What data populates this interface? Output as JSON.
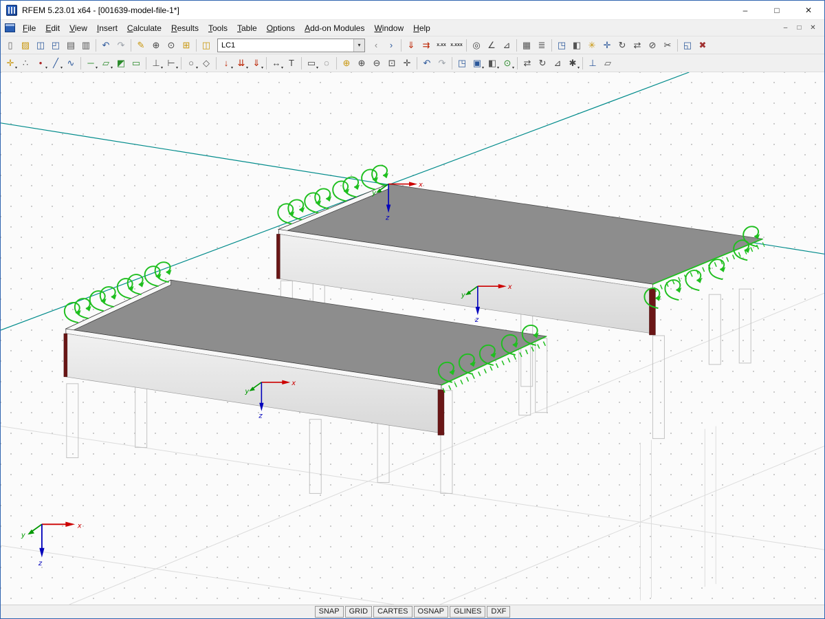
{
  "window": {
    "title": "RFEM 5.23.01 x64 - [001639-model-file-1*]",
    "controls": {
      "minimize": "–",
      "maximize": "□",
      "close": "✕"
    }
  },
  "menubar": {
    "items": [
      "File",
      "Edit",
      "View",
      "Insert",
      "Calculate",
      "Results",
      "Tools",
      "Table",
      "Options",
      "Add-on Modules",
      "Window",
      "Help"
    ],
    "mdi_controls": [
      {
        "n": "mdi-minimize-button",
        "g": "–"
      },
      {
        "n": "mdi-restore-button",
        "g": "□"
      },
      {
        "n": "mdi-close-button",
        "g": "✕"
      }
    ]
  },
  "toolbar_main": {
    "load_case": "LC1",
    "left_icons": [
      {
        "n": "new-file-button",
        "g": "▯",
        "c": "#666"
      },
      {
        "n": "open-file-button",
        "g": "▨",
        "c": "#c8960c"
      },
      {
        "n": "save-button",
        "g": "◫",
        "c": "#2b579a"
      },
      {
        "n": "save-all-button",
        "g": "◰",
        "c": "#2b579a"
      },
      {
        "n": "print-button",
        "g": "▤",
        "c": "#555"
      },
      {
        "n": "print-preview-button",
        "g": "▥",
        "c": "#555"
      },
      {
        "sep": true
      },
      {
        "n": "undo-button",
        "g": "↶",
        "c": "#2b579a"
      },
      {
        "n": "redo-button",
        "g": "↷",
        "c": "#9aa0a8"
      },
      {
        "sep": true
      },
      {
        "n": "edit-button",
        "g": "✎",
        "c": "#c8960c"
      },
      {
        "n": "zoom-select-button",
        "g": "⊕",
        "c": "#444"
      },
      {
        "n": "search-button",
        "g": "⊙",
        "c": "#444"
      },
      {
        "n": "new-window-button",
        "g": "⊞",
        "c": "#c8960c"
      },
      {
        "sep": true
      },
      {
        "n": "load-cases-button",
        "g": "◫",
        "c": "#c8960c"
      }
    ],
    "right_icons": [
      {
        "n": "previous-load-case-button",
        "g": "‹",
        "c": "#888"
      },
      {
        "n": "next-load-case-button",
        "g": "›",
        "c": "#2b579a"
      },
      {
        "sep": true
      },
      {
        "n": "show-loads-button",
        "g": "⇓",
        "c": "#bb2200"
      },
      {
        "n": "show-results-button",
        "g": "⇉",
        "c": "#bb2200"
      },
      {
        "n": "result-values-button",
        "g": "x.xx",
        "small": true,
        "c": "#333"
      },
      {
        "n": "result-digits-button",
        "g": "x.xxx",
        "small": true,
        "c": "#333"
      },
      {
        "sep": true
      },
      {
        "n": "snap-target-button",
        "g": "◎",
        "c": "#444"
      },
      {
        "n": "measure-angle-button",
        "g": "∠",
        "c": "#444"
      },
      {
        "n": "measure-button",
        "g": "⊿",
        "c": "#444"
      },
      {
        "sep": true
      },
      {
        "n": "tables-button",
        "g": "▦",
        "c": "#555"
      },
      {
        "n": "printout-report-button",
        "g": "≣",
        "c": "#555"
      },
      {
        "sep": true
      },
      {
        "n": "isometric-view-button",
        "g": "◳",
        "c": "#2b579a"
      },
      {
        "n": "render-button",
        "g": "◧",
        "c": "#555"
      },
      {
        "n": "lighting-button",
        "g": "✳",
        "c": "#c8960c"
      },
      {
        "n": "axes-button",
        "g": "✛",
        "c": "#2b579a"
      },
      {
        "n": "rotate-view-button",
        "g": "↻",
        "c": "#444"
      },
      {
        "n": "mirror-button",
        "g": "⇄",
        "c": "#444"
      },
      {
        "n": "section-button",
        "g": "⊘",
        "c": "#444"
      },
      {
        "n": "clip-button",
        "g": "✂",
        "c": "#444"
      },
      {
        "sep": true
      },
      {
        "n": "new-child-window-button",
        "g": "◱",
        "c": "#2b579a"
      },
      {
        "n": "close-results-button",
        "g": "✖",
        "c": "#a03030"
      }
    ]
  },
  "toolbar_secondary": {
    "icons": [
      {
        "n": "set-origin-button",
        "g": "✛",
        "c": "#c8960c",
        "dd": true
      },
      {
        "n": "snap-settings-button",
        "g": "∴",
        "c": "#555"
      },
      {
        "n": "new-node-button",
        "g": "•",
        "c": "#aa2222",
        "dd": true
      },
      {
        "n": "new-line-button",
        "g": "╱",
        "c": "#2b579a",
        "dd": true
      },
      {
        "n": "new-polyline-button",
        "g": "∿",
        "c": "#2b579a"
      },
      {
        "sep": true
      },
      {
        "n": "new-member-button",
        "g": "─",
        "c": "#2a8a2a",
        "dd": true
      },
      {
        "n": "new-surface-button",
        "g": "▱",
        "c": "#2a8a2a",
        "dd": true
      },
      {
        "n": "new-solid-button",
        "g": "◩",
        "c": "#2a8a2a"
      },
      {
        "n": "new-opening-button",
        "g": "▭",
        "c": "#2a8a2a"
      },
      {
        "sep": true
      },
      {
        "n": "nodal-support-button",
        "g": "⊥",
        "c": "#555",
        "dd": true
      },
      {
        "n": "line-support-button",
        "g": "⊢",
        "c": "#555",
        "dd": true
      },
      {
        "sep": true
      },
      {
        "n": "member-hinge-button",
        "g": "○",
        "c": "#555",
        "dd": true
      },
      {
        "n": "eccentricity-button",
        "g": "◇",
        "c": "#555"
      },
      {
        "sep": true
      },
      {
        "n": "nodal-load-button",
        "g": "↓",
        "c": "#bb2200",
        "dd": true
      },
      {
        "n": "line-load-button",
        "g": "⇊",
        "c": "#bb2200",
        "dd": true
      },
      {
        "n": "surface-load-button",
        "g": "⇓",
        "c": "#bb2200",
        "dd": true
      },
      {
        "sep": true
      },
      {
        "n": "dimension-button",
        "g": "↔",
        "c": "#444",
        "dd": true
      },
      {
        "n": "text-comment-button",
        "g": "T",
        "c": "#444"
      },
      {
        "sep": true
      },
      {
        "n": "select-button",
        "g": "▭",
        "c": "#444",
        "dd": true
      },
      {
        "n": "select-special-button",
        "g": "◌",
        "c": "#444"
      },
      {
        "sep": true
      },
      {
        "n": "zoom-window-button",
        "g": "⊕",
        "c": "#c8960c"
      },
      {
        "n": "zoom-in-button",
        "g": "⊕",
        "c": "#444"
      },
      {
        "n": "zoom-out-button",
        "g": "⊖",
        "c": "#444"
      },
      {
        "n": "zoom-all-button",
        "g": "⊡",
        "c": "#444"
      },
      {
        "n": "pan-button",
        "g": "✛",
        "c": "#444"
      },
      {
        "sep": true
      },
      {
        "n": "previous-view-button",
        "g": "↶",
        "c": "#2b579a"
      },
      {
        "n": "next-view-button",
        "g": "↷",
        "c": "#9aa0a8"
      },
      {
        "sep": true
      },
      {
        "n": "isometry-button",
        "g": "◳",
        "c": "#2b579a"
      },
      {
        "n": "view-direction-button",
        "g": "▣",
        "c": "#2b579a",
        "dd": true
      },
      {
        "n": "display-properties-button",
        "g": "◧",
        "c": "#555",
        "dd": true
      },
      {
        "n": "visual-objects-button",
        "g": "⊙",
        "c": "#2a8a2a",
        "dd": true
      },
      {
        "sep": true
      },
      {
        "n": "move-copy-button",
        "g": "⇄",
        "c": "#444"
      },
      {
        "n": "rotate-button",
        "g": "↻",
        "c": "#444"
      },
      {
        "n": "align-button",
        "g": "⊿",
        "c": "#444"
      },
      {
        "n": "settings-button",
        "g": "✱",
        "c": "#444",
        "dd": true
      },
      {
        "sep": true
      },
      {
        "n": "user-coordinate-system-button",
        "g": "⊥",
        "c": "#2b579a"
      },
      {
        "n": "work-plane-button",
        "g": "▱",
        "c": "#555"
      }
    ]
  },
  "viewport": {
    "axis_labels": {
      "x": "x",
      "y": "y",
      "z": "z"
    }
  },
  "statusbar": {
    "buttons": [
      "SNAP",
      "GRID",
      "CARTES",
      "OSNAP",
      "GLINES",
      "DXF"
    ]
  },
  "colors": {
    "accent_border": "#2f64b0",
    "guide": "#008b8b",
    "support": "#1fbf1f",
    "slab_top": "#8d8d8d",
    "edge_red": "#6a1616",
    "axis_x": "#cc0000",
    "axis_y": "#009900",
    "axis_z": "#0000bb"
  }
}
